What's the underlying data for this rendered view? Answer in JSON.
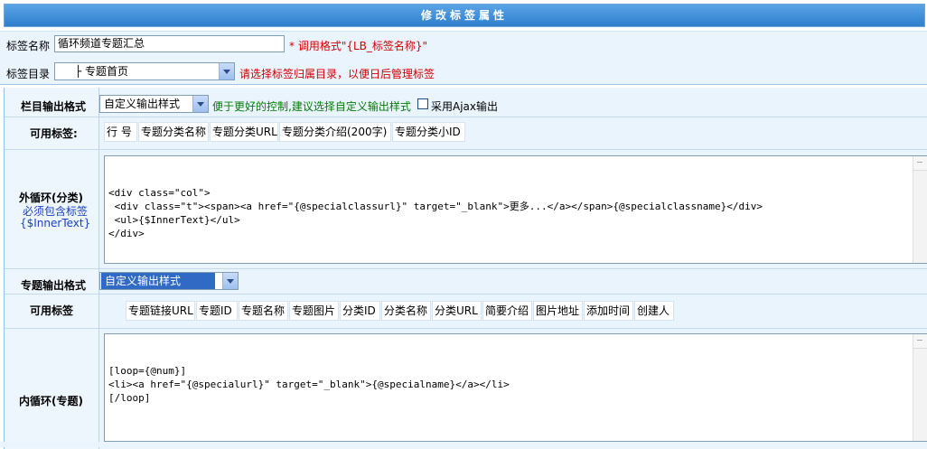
{
  "header": {
    "title": "修改标签属性"
  },
  "top": {
    "name_label": "标签名称",
    "name_value": "循环频道专题汇总",
    "name_hint": "* 调用格式\"{LB_标签名称}\"",
    "dir_label": "标签目录",
    "dir_value": "├ 专题首页",
    "dir_hint": "请选择标签归属目录，以便日后管理标签"
  },
  "column_output": {
    "label": "栏目输出格式",
    "select_value": "自定义输出样式",
    "hint": "便于更好的控制,建议选择自定义输出样式",
    "ajax_label": "采用Ajax输出"
  },
  "available_tags_1": {
    "label": "可用标签:",
    "tags": [
      "行 号",
      "专题分类名称",
      "专题分类URL",
      "专题分类介绍(200字)",
      "专题分类小ID"
    ]
  },
  "outer_loop": {
    "label": "外循环(分类)",
    "note1": "必须包含标签",
    "note2": "{$InnerText}",
    "code": "<div class=\"col\">\n <div class=\"t\"><span><a href=\"{@specialclassurl}\" target=\"_blank\">更多...</a></span>{@specialclassname}</div>\n <ul>{$InnerText}</ul>\n</div>"
  },
  "special_output": {
    "label": "专题输出格式",
    "select_value": "自定义输出样式"
  },
  "available_tags_2": {
    "label": "可用标签",
    "tags": [
      "专题链接URL",
      "专题ID",
      "专题名称",
      "专题图片",
      "分类ID",
      "分类名称",
      "分类URL",
      "简要介绍",
      "图片地址",
      "添加时间",
      "创建人"
    ]
  },
  "inner_loop": {
    "label": "内循环(专题)",
    "code": "[loop={@num}]\n<li><a href=\"{@specialurl}\" target=\"_blank\">{@specialname}</a></li>\n[/loop]"
  }
}
